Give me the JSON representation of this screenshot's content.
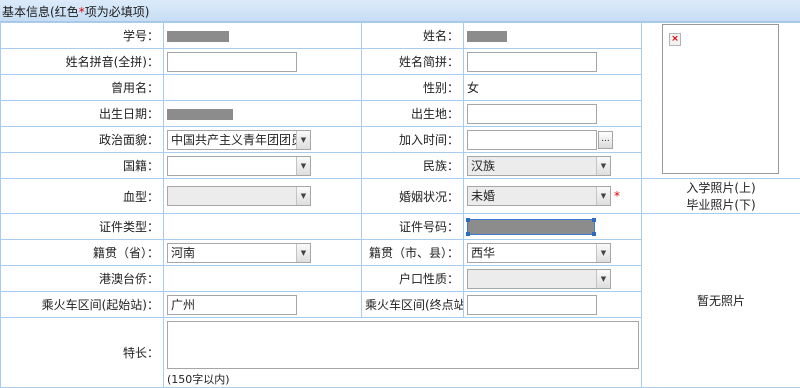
{
  "header": {
    "title_prefix": "基本信息(红色",
    "title_star": "*",
    "title_suffix": "项为必填项)"
  },
  "fields": {
    "student_no": {
      "label": "学号："
    },
    "name": {
      "label": "姓名："
    },
    "pinyin_full": {
      "label": "姓名拼音(全拼)：",
      "value": ""
    },
    "pinyin_short": {
      "label": "姓名简拼：",
      "value": ""
    },
    "former_name": {
      "label": "曾用名："
    },
    "gender": {
      "label": "性别：",
      "value": "女"
    },
    "birth_date": {
      "label": "出生日期："
    },
    "birth_place": {
      "label": "出生地：",
      "value": ""
    },
    "political_status": {
      "label": "政治面貌：",
      "value": "中国共产主义青年团团员"
    },
    "join_date": {
      "label": "加入时间：",
      "value": "",
      "button": "..."
    },
    "nationality": {
      "label": "国籍：",
      "value": ""
    },
    "ethnicity": {
      "label": "民族：",
      "value": "汉族"
    },
    "blood_type": {
      "label": "血型：",
      "value": ""
    },
    "marital_status": {
      "label": "婚姻状况：",
      "value": "未婚",
      "required_mark": "*"
    },
    "id_type": {
      "label": "证件类型："
    },
    "id_number": {
      "label": "证件号码："
    },
    "native_province": {
      "label": "籍贯（省）：",
      "value": "河南"
    },
    "native_city": {
      "label": "籍贯（市、县）：",
      "value": "西华"
    },
    "hk_macao_taiwan": {
      "label": "港澳台侨："
    },
    "household_type": {
      "label": "户口性质：",
      "value": ""
    },
    "train_start": {
      "label": "乘火车区间(起始站)：",
      "value": "广州"
    },
    "train_end": {
      "label": "乘火车区间(终点站)：",
      "value": ""
    },
    "specialty": {
      "label": "特长：",
      "value": "",
      "limit": "(150字以内)"
    }
  },
  "photo": {
    "caption_line1": "入学照片(上)",
    "caption_line2": "毕业照片(下)",
    "no_photo": "暂无照片",
    "broken_icon": "×"
  }
}
